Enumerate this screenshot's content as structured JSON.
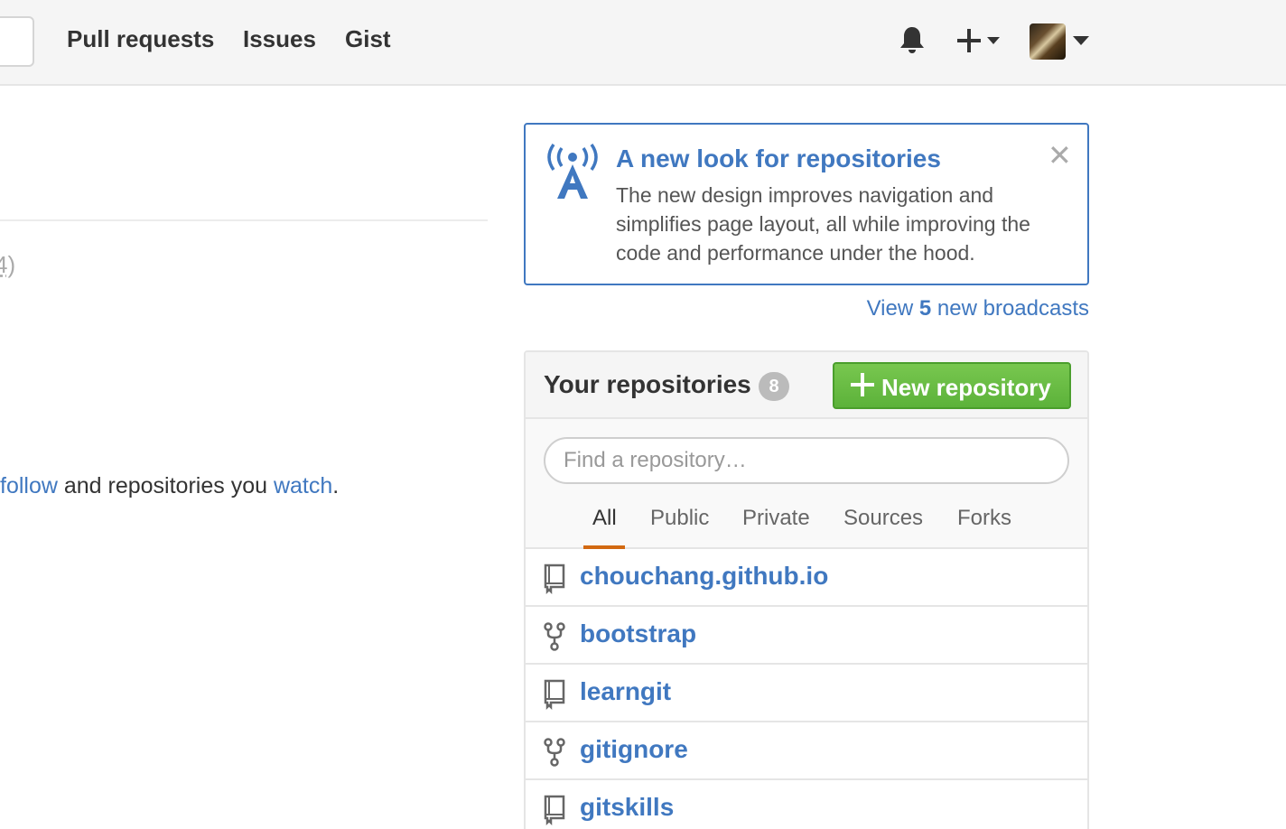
{
  "header": {
    "nav": [
      "Pull requests",
      "Issues",
      "Gist"
    ]
  },
  "left": {
    "count_fragment": "4)",
    "follow_line": {
      "link_follow": "follow",
      "mid_text": " and repositories you ",
      "link_watch": "watch",
      "end_text": "."
    }
  },
  "broadcast": {
    "title": "A new look for repositories",
    "body": "The new design improves navigation and simplifies page layout, all while improving the code and performance under the hood.",
    "close_glyph": "✕",
    "link_prefix": "View ",
    "link_count": "5",
    "link_suffix": " new broadcasts"
  },
  "repos": {
    "title": "Your repositories",
    "count": "8",
    "new_button": "New repository",
    "search_placeholder": "Find a repository…",
    "tabs": [
      "All",
      "Public",
      "Private",
      "Sources",
      "Forks"
    ],
    "active_tab": "All",
    "accent_color": "#d26911",
    "items": [
      {
        "name": "chouchang.github.io",
        "icon": "repo-icon"
      },
      {
        "name": "bootstrap",
        "icon": "fork-icon"
      },
      {
        "name": "learngit",
        "icon": "repo-icon"
      },
      {
        "name": "gitignore",
        "icon": "fork-icon"
      },
      {
        "name": "gitskills",
        "icon": "repo-icon"
      }
    ]
  },
  "colors": {
    "link": "#4078c0",
    "button_green": "#6cc644"
  }
}
